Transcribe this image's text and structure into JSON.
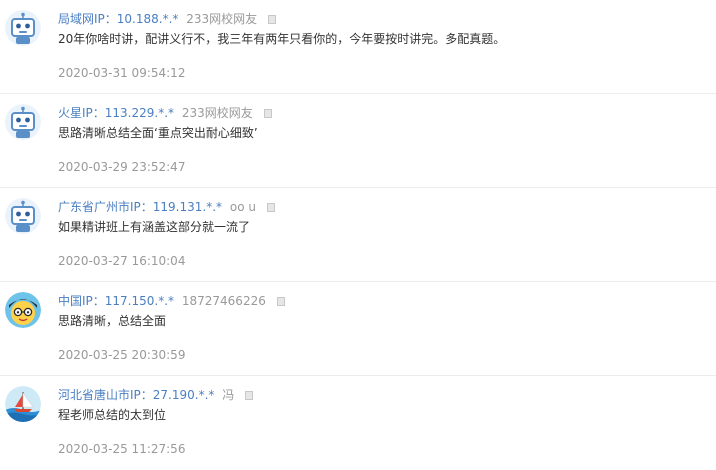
{
  "comments": [
    {
      "user": "局域网IP：10.188.*.*",
      "tag": "233网校网友",
      "avatar": "robot-icon",
      "content": "20年你啥时讲，配讲义行不，我三年有两年只看你的，今年要按时讲完。多配真题。",
      "time": "2020-03-31 09:54:12"
    },
    {
      "user": "火星IP：113.229.*.*",
      "tag": "233网校网友",
      "avatar": "robot-icon",
      "content": "思路清晰总结全面‘重点突出耐心细致’",
      "time": "2020-03-29 23:52:47"
    },
    {
      "user": "广东省广州市IP：119.131.*.*",
      "tag": "oo u",
      "avatar": "robot-icon",
      "content": "如果精讲班上有涵盖这部分就一流了",
      "time": "2020-03-27 16:10:04"
    },
    {
      "user": "中国IP：117.150.*.*",
      "tag": "18727466226",
      "avatar": "cartoon-face-icon",
      "content": "思路清晰，总结全面",
      "time": "2020-03-25 20:30:59"
    },
    {
      "user": "河北省唐山市IP：27.190.*.*",
      "tag": "冯",
      "avatar": "sailboat-icon",
      "content": "程老师总结的太到位",
      "time": "2020-03-25 11:27:56"
    }
  ],
  "colors": {
    "name_link": "#4a7fc1",
    "muted_text": "#999999",
    "body_text": "#333333",
    "divider": "#ececec"
  },
  "icons": {
    "report": "report-icon"
  }
}
